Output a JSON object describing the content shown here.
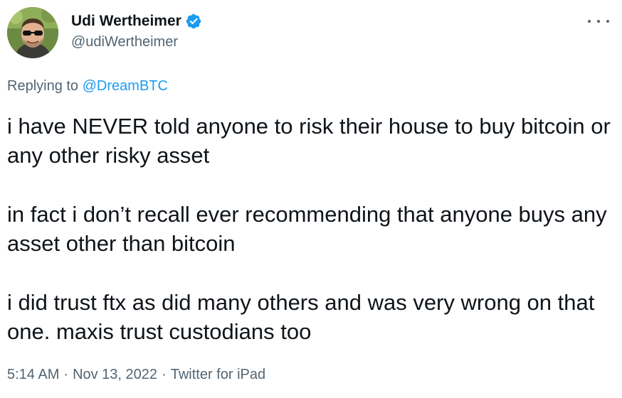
{
  "tweet": {
    "author": {
      "display_name": "Udi Wertheimer",
      "handle": "@udiWertheimer",
      "verified": true,
      "avatar_icon": "profile-photo"
    },
    "more_icon": "more-options-icon",
    "reply": {
      "prefix": "Replying to",
      "mention": "@DreamBTC"
    },
    "paragraphs": [
      "i have NEVER told anyone to risk their house to buy bitcoin or any other risky asset",
      "in fact i don’t recall ever recommending that anyone buys any asset other than bitcoin",
      "i did trust ftx as did many others and was very wrong on that one. maxis trust custodians too"
    ],
    "meta": {
      "time": "5:14 AM",
      "separator": "·",
      "date": "Nov 13, 2022",
      "source": "Twitter for iPad"
    }
  },
  "colors": {
    "text": "#0f1419",
    "secondary": "#536471",
    "link": "#1d9bf0",
    "verified": "#1d9bf0"
  }
}
